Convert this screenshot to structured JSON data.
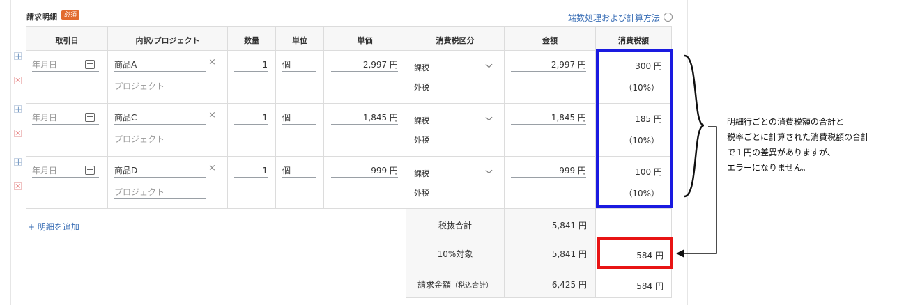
{
  "section": {
    "title": "請求明細",
    "required_badge": "必須",
    "calc_link": "端数処理および計算方法",
    "info_icon": "info-icon"
  },
  "table": {
    "headers": [
      "取引日",
      "内訳/プロジェクト",
      "数量",
      "単位",
      "単価",
      "消費税区分",
      "金額",
      "消費税額"
    ],
    "rows": [
      {
        "date_placeholder": "年月日",
        "item": "商品A",
        "project_placeholder": "プロジェクト",
        "qty": "1",
        "unit": "個",
        "unit_price": "2,997 円",
        "tax_type": "課税",
        "tax_sub": "外税",
        "amount": "2,997 円",
        "tax_amount": "300 円",
        "tax_rate": "（10%）"
      },
      {
        "date_placeholder": "年月日",
        "item": "商品C",
        "project_placeholder": "プロジェクト",
        "qty": "1",
        "unit": "個",
        "unit_price": "1,845 円",
        "tax_type": "課税",
        "tax_sub": "外税",
        "amount": "1,845 円",
        "tax_amount": "185 円",
        "tax_rate": "（10%）"
      },
      {
        "date_placeholder": "年月日",
        "item": "商品D",
        "project_placeholder": "プロジェクト",
        "qty": "1",
        "unit": "個",
        "unit_price": "999 円",
        "tax_type": "課税",
        "tax_sub": "外税",
        "amount": "999 円",
        "tax_amount": "100 円",
        "tax_rate": "（10%）"
      }
    ],
    "add_row": "+ 明細を追加"
  },
  "summary": {
    "subtotal_label": "税抜合計",
    "subtotal_amount": "5,841 円",
    "taxable_label": "10%対象",
    "taxable_amount": "5,841 円",
    "taxable_tax": "584 円",
    "total_label": "請求金額",
    "total_label_sub": "（税込合計）",
    "total_amount": "6,425 円",
    "total_tax": "584 円"
  },
  "annotation": {
    "note_lines": [
      "明細行ごとの消費税額の合計と",
      "税率ごとに計算された消費税額の合計",
      "で１円の差異がありますが、",
      "エラーになりません。"
    ],
    "colors": {
      "blue_box": "#1a1ae0",
      "red_box": "#e81414"
    }
  }
}
